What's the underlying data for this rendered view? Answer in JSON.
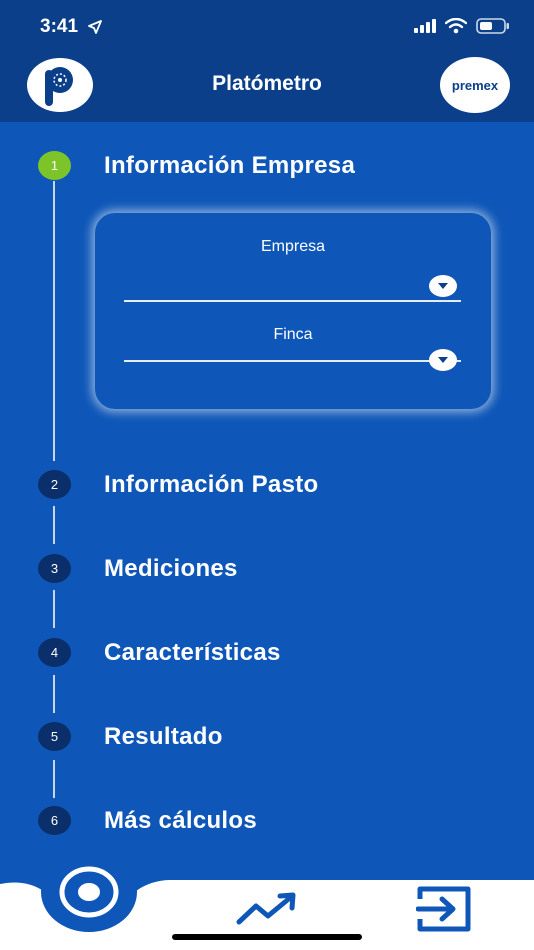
{
  "status_bar": {
    "time": "3:41",
    "location_icon": "location-arrow-icon",
    "signal_icon": "cellular-signal-icon",
    "wifi_icon": "wifi-icon",
    "battery_icon": "battery-icon"
  },
  "header": {
    "title": "Platómetro",
    "left_logo": "platometro-logo",
    "right_logo_text": "premex"
  },
  "steps": [
    {
      "number": "1",
      "label": "Información Empresa",
      "active": true
    },
    {
      "number": "2",
      "label": "Información Pasto",
      "active": false
    },
    {
      "number": "3",
      "label": "Mediciones",
      "active": false
    },
    {
      "number": "4",
      "label": "Características",
      "active": false
    },
    {
      "number": "5",
      "label": "Resultado",
      "active": false
    },
    {
      "number": "6",
      "label": "Más cálculos",
      "active": false
    }
  ],
  "form": {
    "empresa_label": "Empresa",
    "empresa_value": "",
    "finca_label": "Finca",
    "finca_value": ""
  },
  "bottom_nav": {
    "home_icon": "target-icon",
    "stats_icon": "trending-up-icon",
    "logout_icon": "logout-icon"
  },
  "colors": {
    "background": "#0e57b8",
    "header": "#0b3f8a",
    "step_active": "#7dc42a",
    "step_inactive": "#0b2f6b",
    "bottom_bar": "#ffffff"
  }
}
